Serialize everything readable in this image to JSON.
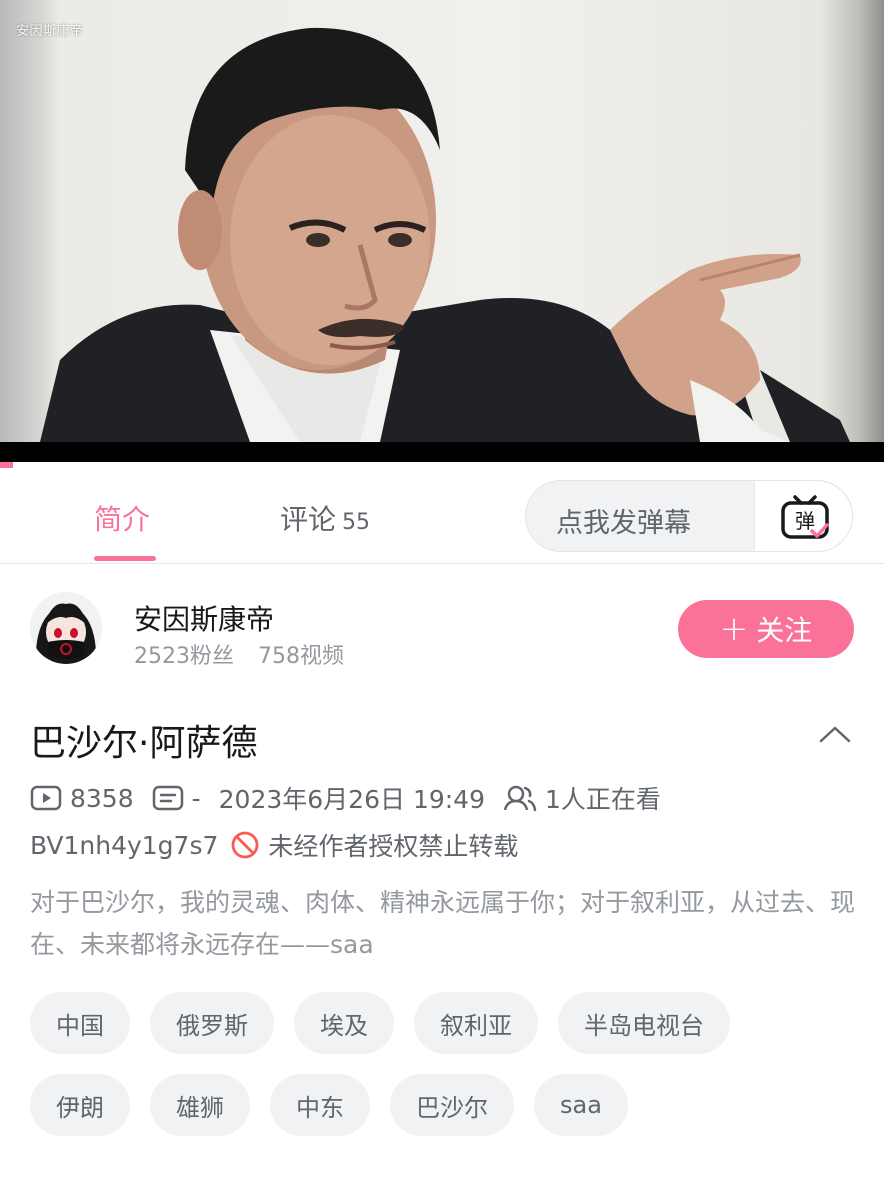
{
  "player": {
    "watermark": "安因斯康帝",
    "progress_fraction": 0.015
  },
  "tabs": {
    "intro_label": "简介",
    "comments_label": "评论",
    "comments_count": "55",
    "danmaku_placeholder": "点我发弹幕",
    "danmaku_icon": "弹"
  },
  "uploader": {
    "name": "安因斯康帝",
    "followers": "2523粉丝",
    "videos": "758视频",
    "follow_label": "关注",
    "follow_plus": "+"
  },
  "video": {
    "title": "巴沙尔·阿萨德",
    "views": "8358",
    "danmaku_sep": "-",
    "date": "2023年6月26日 19:49",
    "watching": "1人正在看",
    "bvid": "BV1nh4y1g7s7",
    "copyright": "未经作者授权禁止转载",
    "description": "对于巴沙尔，我的灵魂、肉体、精神永远属于你；对于叙利亚，从过去、现在、未来都将永远存在——saa"
  },
  "tags": {
    "row1": [
      "中国",
      "俄罗斯",
      "埃及",
      "叙利亚",
      "半岛电视台"
    ],
    "row2": [
      "伊朗",
      "雄狮",
      "中东",
      "巴沙尔",
      "saa"
    ]
  },
  "colors": {
    "accent": "#fb7299",
    "text_primary": "#18191c",
    "text_secondary": "#61666d",
    "text_tertiary": "#9499a0",
    "tag_bg": "#f1f2f3"
  }
}
